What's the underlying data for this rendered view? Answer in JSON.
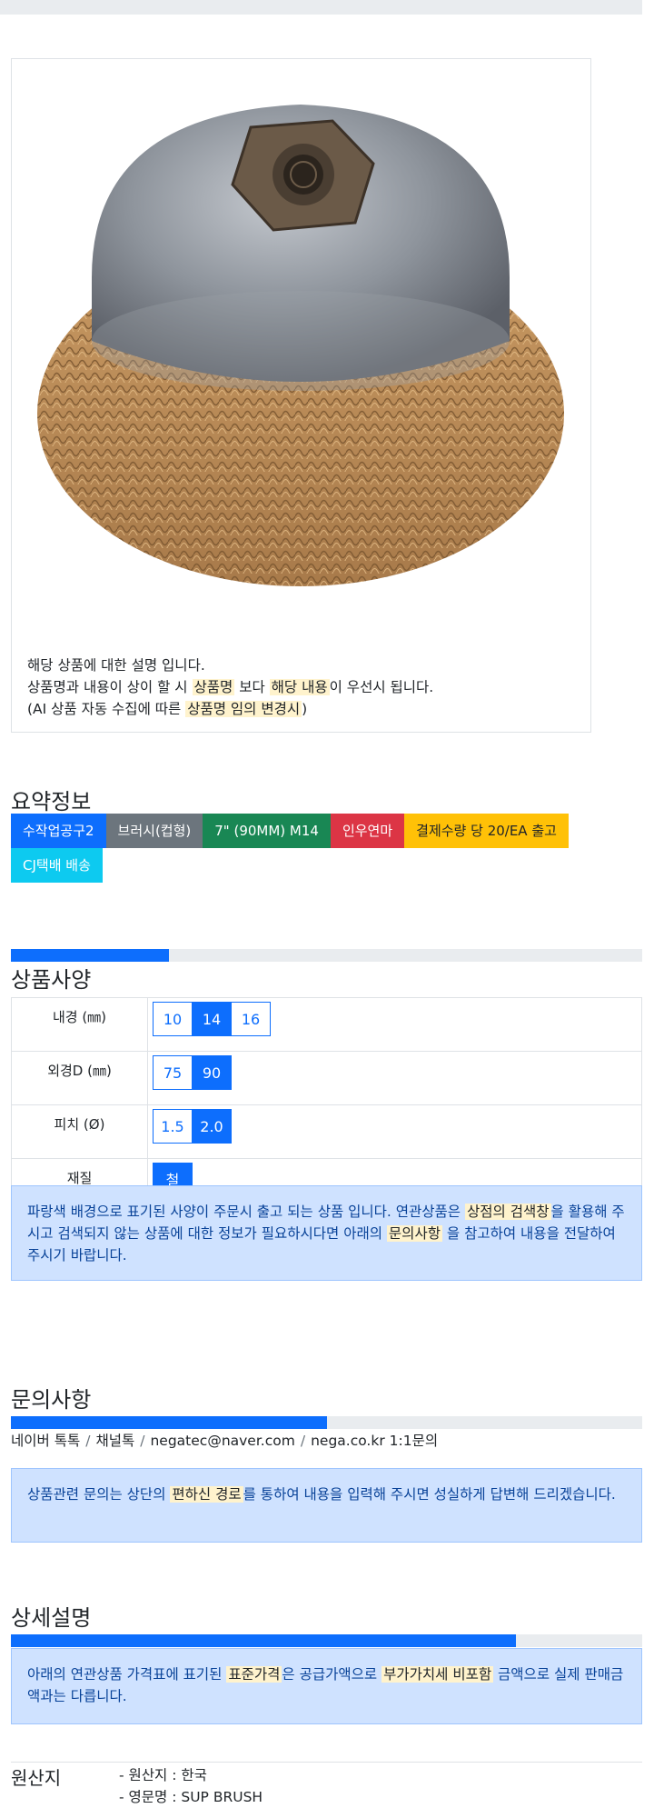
{
  "image_description": {
    "line1": "해당 상품에 대한 설명 입니다.",
    "line2_a": "상품명과 내용이 상이 할 시 ",
    "line2_hl1": "상품명",
    "line2_b": " 보다 ",
    "line2_hl2": "해당 내용",
    "line2_c": "이 우선시 됩니다.",
    "line3_a": "(AI 상품 자동 수집에 따른 ",
    "line3_hl": "상품명 임의 변경시",
    "line3_b": ")"
  },
  "summary": {
    "title": "요약정보",
    "badges": [
      "수작업공구2",
      "브러시(컵형)",
      "7\" (90MM) M14",
      "인우연마",
      "결제수량 당 20/EA 출고",
      "CJ택배 배송"
    ]
  },
  "spec": {
    "title": "상품사양",
    "progress": 0.25,
    "rows": [
      {
        "label": "내경 (㎜)",
        "options": [
          "10",
          "14",
          "16"
        ],
        "selected": "14"
      },
      {
        "label": "외경D (㎜)",
        "options": [
          "75",
          "90"
        ],
        "selected": "90"
      },
      {
        "label": "피치 (Ø)",
        "options": [
          "1.5",
          "2.0"
        ],
        "selected": "2.0"
      },
      {
        "label": "재질",
        "options": [
          "철"
        ],
        "selected": "철"
      }
    ],
    "notice_a": "파랑색 배경으로 표기된 사양이 주문시 출고 되는 상품 입니다. 연관상품은 ",
    "notice_hl1": "상점의 검색창",
    "notice_b": "을 활용해 주시고 검색되지 않는 상품에 대한 정보가 필요하시다면 아래의 ",
    "notice_hl2": "문의사항",
    "notice_c": " 을 참고하여 내용을 전달하여 주시기 바랍니다."
  },
  "inquiry": {
    "title": "문의사항",
    "progress": 0.5,
    "contacts": [
      "네이버 톡톡",
      "채널톡",
      "negatec@naver.com",
      "nega.co.kr 1:1문의"
    ],
    "notice_a": "상품관련 문의는 상단의 ",
    "notice_hl": "편하신 경로",
    "notice_b": "를 통하여 내용을 입력해 주시면 성실하게 답변해 드리겠습니다."
  },
  "detail": {
    "title": "상세설명",
    "progress": 0.8,
    "notice_a": "아래의 연관상품 가격표에 표기된 ",
    "notice_hl1": "표준가격",
    "notice_b": "은 공급가액으로 ",
    "notice_hl2": "부가가치세 비포함",
    "notice_c": " 금액으로 실제 판매금액과는 다릅니다."
  },
  "origin": {
    "label": "원산지",
    "lines": [
      "- 원산지 : 한국",
      "- 영문명 : SUP BRUSH"
    ]
  },
  "colors": {
    "primary": "#0d6efd",
    "alert_bg": "#cfe2ff",
    "highlight": "#fff3cd"
  }
}
